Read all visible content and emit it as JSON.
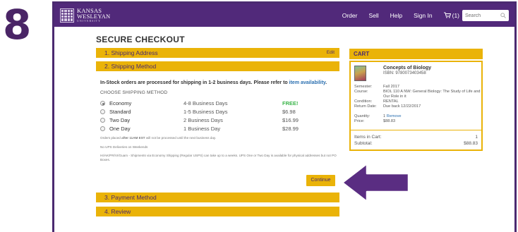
{
  "step_number": "8",
  "nav": {
    "logo_line1": "KANSAS",
    "logo_line2": "WESLEYAN",
    "logo_line3": "UNIVERSITY",
    "links": [
      "Order",
      "Sell",
      "Help",
      "Sign In"
    ],
    "cart_count": "(1)",
    "search_placeholder": "Search"
  },
  "page_title": "SECURE CHECKOUT",
  "sections": {
    "shipping_address": "1. Shipping Address",
    "edit": "Edit",
    "shipping_method": "2. Shipping Method",
    "payment_method": "3. Payment Method",
    "review": "4. Review"
  },
  "shipping": {
    "note_text": "In-Stock orders are processed for shipping in 1-2 business days. Please refer to ",
    "note_link": "item availability",
    "note_end": ".",
    "choose_label": "CHOOSE SHIPPING METHOD",
    "options": [
      {
        "name": "Economy",
        "days": "4-8 Business Days",
        "price": "FREE!",
        "selected": true
      },
      {
        "name": "Standard",
        "days": "1-5 Business Days",
        "price": "$6.98",
        "selected": false
      },
      {
        "name": "Two Day",
        "days": "2 Business Days",
        "price": "$16.99",
        "selected": false
      },
      {
        "name": "One Day",
        "days": "1 Business Day",
        "price": "$28.99",
        "selected": false
      }
    ],
    "fine1_pre": "Orders placed ",
    "fine1_bold": "after 11AM EST",
    "fine1_post": " will not be processed until the next business day.",
    "fine2": "No UPS Deliveries on Weekends",
    "fine3": "HI/AK/PR/VI/Guam - Shipments via Economy Shipping (Regular USPS) can take up to a weeks. UPS One or Two Day is available for physical addresses but not PO Boxes.",
    "continue_label": "Continue"
  },
  "cart": {
    "heading": "CART",
    "item_title": "Concepts of Biology",
    "isbn": "ISBN: 9780073403458",
    "labels": {
      "semester": "Semester:",
      "course": "Course:",
      "condition": "Condition:",
      "return_date": "Return Date:",
      "quantity": "Quantity:",
      "price": "Price:"
    },
    "values": {
      "semester": "Fall 2017",
      "course": "BIOL 110 A NW: General Biology: The Study of Life and Our Role in it",
      "condition": "RENTAL",
      "return_date": "Due back 12/22/2017",
      "quantity": "1",
      "remove": "Remove",
      "price": "$88.83"
    },
    "items_label": "Items in Cart:",
    "items_count": "1",
    "subtotal_label": "Subtotal:",
    "subtotal": "$88.83"
  },
  "colors": {
    "brand_purple": "#51297a",
    "accent_gold": "#eab308",
    "free_green": "#3bb54a",
    "link_blue": "#2a6fb0"
  }
}
